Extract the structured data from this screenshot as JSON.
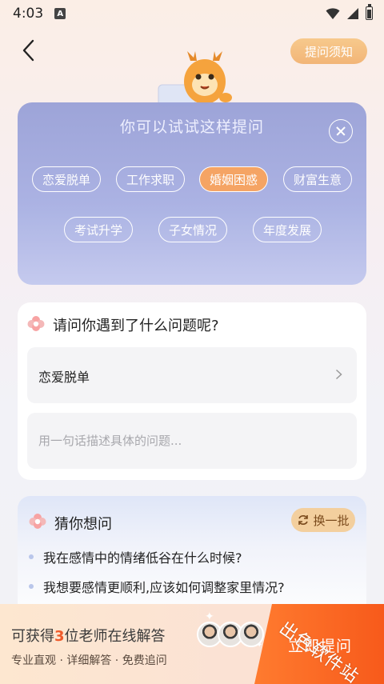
{
  "status_bar": {
    "time": "4:03",
    "notification_badge": "A"
  },
  "header": {
    "notice_label": "提问须知"
  },
  "suggest_panel": {
    "title": "你可以试试这样提问",
    "chips": [
      {
        "label": "恋爱脱单",
        "active": false
      },
      {
        "label": "工作求职",
        "active": false
      },
      {
        "label": "婚姻困惑",
        "active": true
      },
      {
        "label": "财富生意",
        "active": false
      },
      {
        "label": "考试升学",
        "active": false
      },
      {
        "label": "子女情况",
        "active": false
      },
      {
        "label": "年度发展",
        "active": false
      }
    ]
  },
  "question_form": {
    "title": "请问你遇到了什么问题呢?",
    "topic_value": "恋爱脱单",
    "description_placeholder": "用一句话描述具体的问题..."
  },
  "guess_panel": {
    "title": "猜你想问",
    "refresh_label": "换一批",
    "items": [
      "我在感情中的情绪低谷在什么时候?",
      "我想要感情更顺利,应该如何调整家里情况?"
    ]
  },
  "bottom_bar": {
    "line1_prefix": "可获得",
    "line1_count": "3",
    "line1_suffix": "位老师在线解答",
    "line2": "专业直观 · 详细解答 · 免费追问",
    "cta_label": "立即提问"
  },
  "watermark": "出色软件站",
  "colors": {
    "accent_orange": "#f5a25f",
    "cta_orange": "#f75a1b",
    "panel_purple": "#9aa2d8",
    "highlight_red": "#ef5a2a"
  }
}
